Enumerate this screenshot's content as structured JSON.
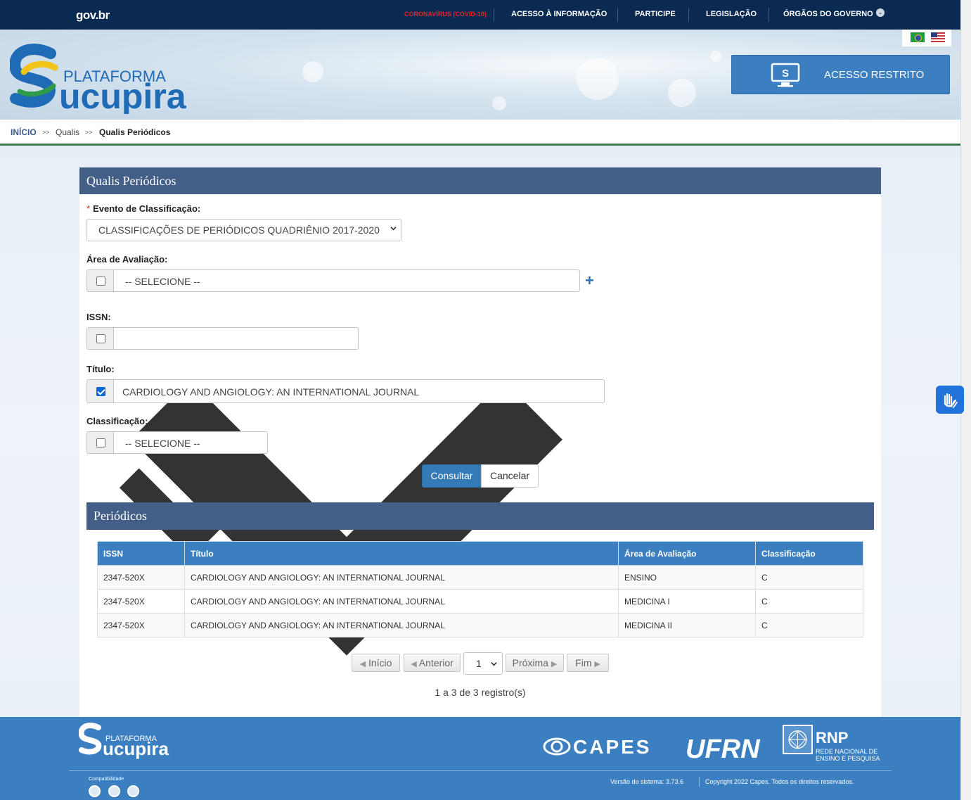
{
  "gov_bar": {
    "logo": "gov.br",
    "links": [
      "CORONAVÍRUS (COVID-19)",
      "ACESSO À INFORMAÇÃO",
      "PARTICIPE",
      "LEGISLAÇÃO",
      "ÓRGÃOS DO GOVERNO"
    ]
  },
  "header": {
    "logo_top": "PLATAFORMA",
    "logo_main": "ucupira",
    "logo_initial": "S",
    "acesso_restrito": "ACESSO RESTRITO",
    "flags": [
      "brazil-flag-icon",
      "usa-flag-icon"
    ]
  },
  "breadcrumb": {
    "home": "INÍCIO",
    "sep": ">>",
    "qualis": "Qualis",
    "current": "Qualis Periódicos"
  },
  "form": {
    "title": "Qualis Periódicos",
    "evento_label": "Evento de Classificação:",
    "required_mark": "*",
    "evento_value": "CLASSIFICAÇÕES DE PERIÓDICOS QUADRIÊNIO 2017-2020",
    "area_label": "Área de Avaliação:",
    "area_value": "-- SELECIONE --",
    "area_checked": false,
    "issn_label": "ISSN:",
    "issn_value": "",
    "issn_checked": false,
    "titulo_label": "Título:",
    "titulo_value": "CARDIOLOGY AND ANGIOLOGY: AN INTERNATIONAL JOURNAL",
    "titulo_checked": true,
    "classificacao_label": "Classificação:",
    "classificacao_value": "-- SELECIONE --",
    "classificacao_checked": false,
    "consultar": "Consultar",
    "cancelar": "Cancelar"
  },
  "results": {
    "title": "Periódicos",
    "columns": [
      "ISSN",
      "Título",
      "Área de Avaliação",
      "Classificação"
    ],
    "rows": [
      [
        "2347-520X",
        "CARDIOLOGY AND ANGIOLOGY: AN INTERNATIONAL JOURNAL",
        "ENSINO",
        "C"
      ],
      [
        "2347-520X",
        "CARDIOLOGY AND ANGIOLOGY: AN INTERNATIONAL JOURNAL",
        "MEDICINA I",
        "C"
      ],
      [
        "2347-520X",
        "CARDIOLOGY AND ANGIOLOGY: AN INTERNATIONAL JOURNAL",
        "MEDICINA II",
        "C"
      ]
    ],
    "pagination": {
      "inicio": "Início",
      "anterior": "Anterior",
      "page": "1",
      "proxima": "Próxima",
      "fim": "Fim"
    },
    "records": "1 a 3 de 3 registro(s)"
  },
  "footer": {
    "logo_top": "PLATAFORMA",
    "logo_main": "ucupira",
    "logo_initial": "S",
    "capes": "CAPES",
    "ufrn": "UFRN",
    "rnp": "RNP",
    "rnp_sub1": "REDE NACIONAL DE",
    "rnp_sub2": "ENSINO E PESQUISA",
    "compat": "Compatibilidade",
    "version": "Versão do sistema: 3.73.6",
    "copyright": "Copyright 2022 Capes. Todos os direitos reservados."
  },
  "colors": {
    "gov_bar": "#0b2a52",
    "panel_header": "#435f87",
    "accent_blue": "#3b7fc1",
    "covid_red": "#e0262b"
  }
}
